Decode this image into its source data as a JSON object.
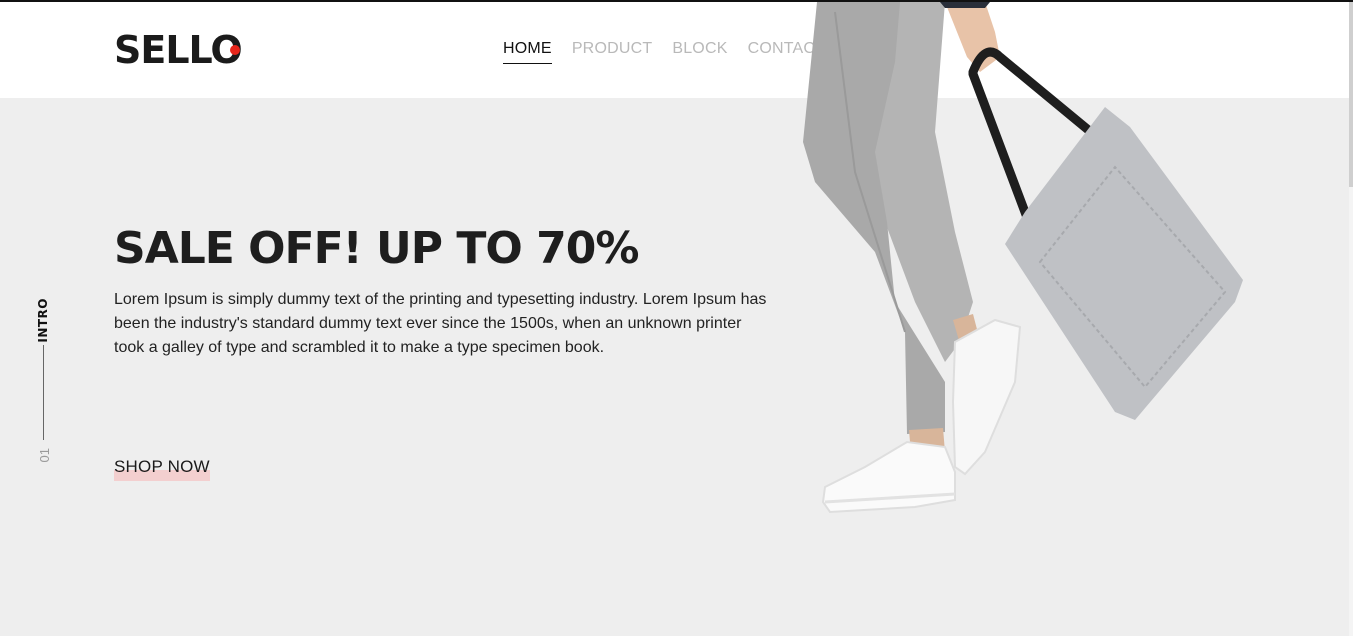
{
  "brand": {
    "logo_text": "SELLO",
    "accent_color": "#e8261b"
  },
  "nav": {
    "items": [
      {
        "label": "HOME",
        "active": true
      },
      {
        "label": "PRODUCT",
        "active": false
      },
      {
        "label": "BLOCK",
        "active": false
      },
      {
        "label": "CONTACT",
        "active": false
      }
    ]
  },
  "hero": {
    "side_label": "INTRO",
    "side_number": "01",
    "headline": "SALE OFF! UP TO 70%",
    "description": "Lorem Ipsum is simply dummy text of the printing and typesetting industry. Lorem Ipsum has been the industry's standard dummy text ever since the 1500s, when an unknown printer took a galley of type and scrambled it to make a type specimen book.",
    "cta_label": "SHOP NOW",
    "cta_highlight_color": "#f3cfcf"
  },
  "colors": {
    "header_bg": "#ffffff",
    "hero_bg": "#eeeeee",
    "nav_inactive": "#b9b9b9"
  }
}
